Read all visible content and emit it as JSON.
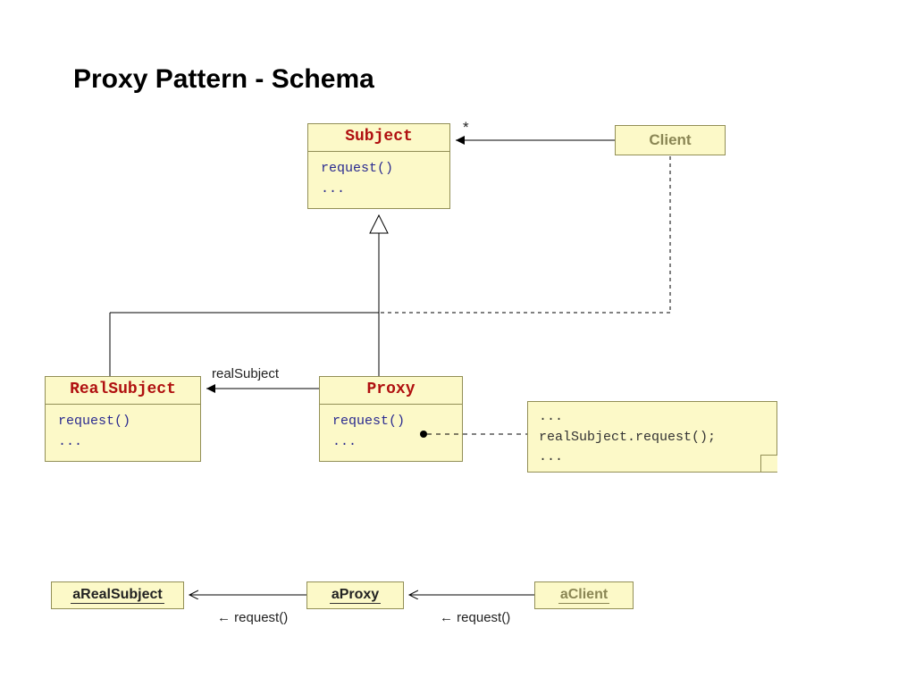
{
  "title": "Proxy Pattern - Schema",
  "subject": {
    "name": "Subject",
    "ops": "request()\n..."
  },
  "client": {
    "name": "Client"
  },
  "realsubject": {
    "name": "RealSubject",
    "ops": "request()\n..."
  },
  "proxy": {
    "name": "Proxy",
    "ops": "request()\n..."
  },
  "note": "...\nrealSubject.request();\n...",
  "assoc": {
    "star": "*",
    "realSubject": "realSubject"
  },
  "objects": {
    "areal": "aRealSubject",
    "aproxy": "aProxy",
    "aclient": "aClient",
    "req1": "← request()",
    "req2": "← request()"
  }
}
